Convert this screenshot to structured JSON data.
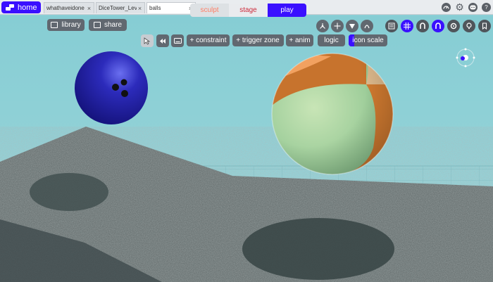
{
  "header": {
    "home_label": "home",
    "tabs": [
      {
        "label": "whathaveidone",
        "close": "×"
      },
      {
        "label": "DiceTower_Leve...",
        "close": "×"
      },
      {
        "label": "balls",
        "close": "×"
      }
    ]
  },
  "toolbar": {
    "library_label": "library",
    "share_label": "share",
    "modes": [
      "sculpt",
      "stage",
      "play"
    ],
    "active_mode": "play",
    "constraint_label": "+ constraint",
    "trigger_zone_label": "+ trigger zone",
    "anim_label": "+ anim",
    "logic_label": "logic",
    "icon_scale_label": "icon scale"
  },
  "icons": {
    "top_right": [
      "speedometer-icon",
      "gear-icon",
      "discord-icon",
      "help-icon"
    ],
    "transform": [
      "move-nodes-icon",
      "move-arrows-icon",
      "shield-icon",
      "physics-icon"
    ],
    "view": [
      "list-icon",
      "grid-icon",
      "magnet-icon",
      "magnet-active-icon",
      "settings-icon",
      "lightbulb-icon",
      "bookmark-icon"
    ]
  },
  "colors": {
    "accent": "#3a10ff",
    "sculpt_text": "#ff7f66",
    "stage_text": "#cc2b3b",
    "sky": "#8fd0d6",
    "ground": "#6d7777"
  }
}
